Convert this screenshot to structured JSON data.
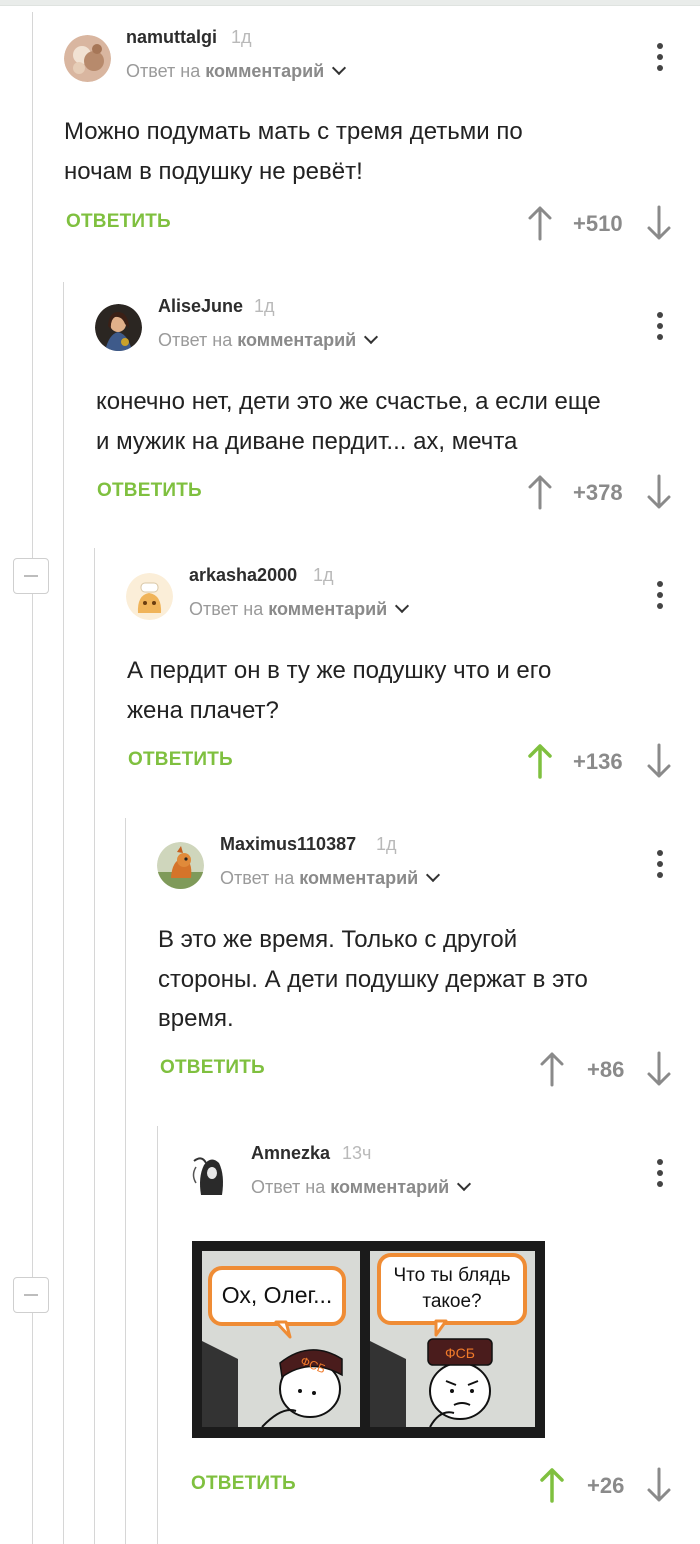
{
  "reply_label": "ОТВЕТИТЬ",
  "reply_to_prefix": "Ответ на",
  "reply_to_target": "комментарий",
  "comments": [
    {
      "username": "namuttalgi",
      "time": "1д",
      "text_lines": [
        "Можно подумать мать с тремя детьми по",
        "ночам в подушку не ревёт!"
      ],
      "score": "+510",
      "upvoted": false
    },
    {
      "username": "AliseJune",
      "time": "1д",
      "text_lines": [
        "конечно нет, дети это же счастье, а если еще",
        "и мужик на диване пердит... ах, мечта"
      ],
      "score": "+378",
      "upvoted": false
    },
    {
      "username": "arkasha2000",
      "time": "1д",
      "text_lines": [
        "А пердит он в ту же подушку что и его",
        "жена плачет?"
      ],
      "score": "+136",
      "upvoted": true
    },
    {
      "username": "Maximus110387",
      "time": "1д",
      "text_lines": [
        "В это же время. Только с другой",
        "стороны. А дети подушку держат в это",
        "время."
      ],
      "score": "+86",
      "upvoted": false
    },
    {
      "username": "Amnezka",
      "time": "13ч",
      "text_lines": [],
      "score": "+26",
      "upvoted": true,
      "image": {
        "left_panel_text": "Ох, Олег...",
        "right_panel_text_lines": [
          "Что ты блядь",
          "такое?"
        ],
        "cap_text": "ФСБ"
      }
    }
  ],
  "colors": {
    "accent": "#7fc03f",
    "score": "#8a8a8a",
    "arrow": "#8a8a8a",
    "text": "#222222"
  }
}
